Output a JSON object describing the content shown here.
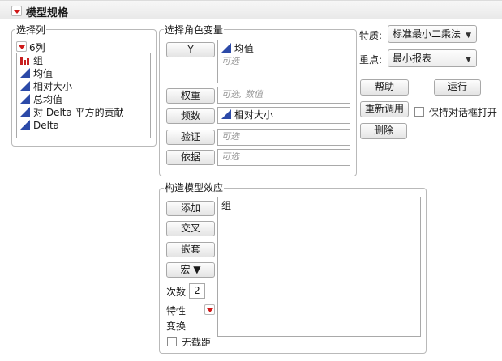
{
  "title": "模型规格",
  "select_columns": {
    "group_label": "选择列",
    "count_label": "6列",
    "items": [
      {
        "label": "组",
        "icon": "nominal-bar-icon"
      },
      {
        "label": "均值",
        "icon": "continuous-triangle-icon"
      },
      {
        "label": "相对大小",
        "icon": "continuous-triangle-icon"
      },
      {
        "label": "总均值",
        "icon": "continuous-triangle-icon"
      },
      {
        "label": "对 Delta 平方的贡献",
        "icon": "continuous-triangle-icon"
      },
      {
        "label": "Delta",
        "icon": "continuous-triangle-icon"
      }
    ]
  },
  "roles": {
    "group_label": "选择角色变量",
    "y_button": "Y",
    "y_value": "均值",
    "y_placeholder": "可选",
    "weight_button": "权重",
    "weight_placeholder": "可选, 数值",
    "freq_button": "频数",
    "freq_value": "相对大小",
    "validation_button": "验证",
    "validation_placeholder": "可选",
    "by_button": "依据",
    "by_placeholder": "可选"
  },
  "options": {
    "personality_label": "特质:",
    "personality_value": "标准最小二乘法",
    "emphasis_label": "重点:",
    "emphasis_value": "最小报表",
    "help_button": "帮助",
    "run_button": "运行",
    "recall_button": "重新调用",
    "keep_open_label": "保持对话框打开",
    "remove_button": "删除"
  },
  "effects": {
    "group_label": "构造模型效应",
    "add_button": "添加",
    "cross_button": "交叉",
    "nest_button": "嵌套",
    "macros_button": "宏 ▼",
    "degree_label": "次数",
    "degree_value": "2",
    "attributes_label": "特性",
    "transform_label": "变换",
    "no_intercept_label": "无截距",
    "effects_list": [
      "组"
    ]
  },
  "colors": {
    "accent_red": "#d01818",
    "continuous_blue": "#2c4aa8",
    "nominal_red": "#c82020"
  }
}
